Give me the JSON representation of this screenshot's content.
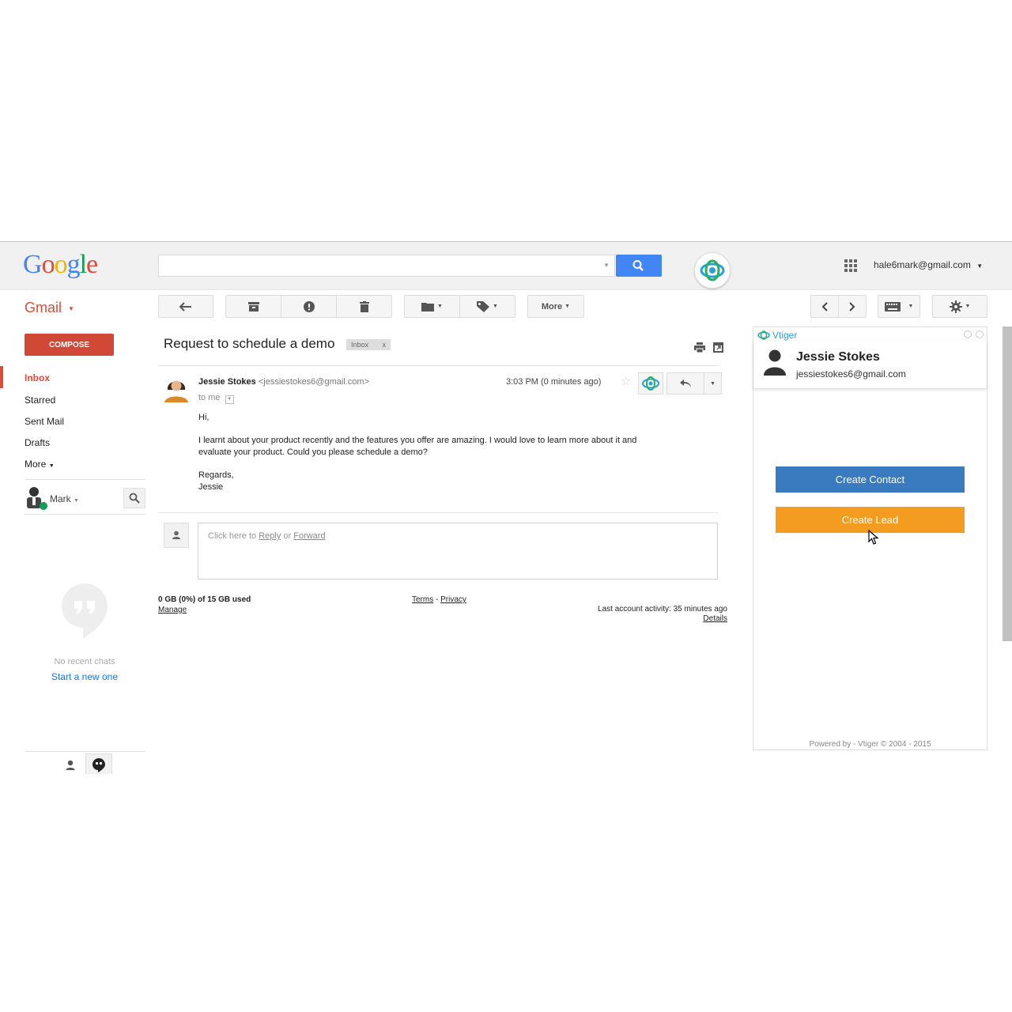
{
  "header": {
    "logo_letters": [
      {
        "char": "G",
        "color": "#4285f4"
      },
      {
        "char": "o",
        "color": "#dd4b39"
      },
      {
        "char": "o",
        "color": "#f4b400"
      },
      {
        "char": "g",
        "color": "#4285f4"
      },
      {
        "char": "l",
        "color": "#0f9d58"
      },
      {
        "char": "e",
        "color": "#dd4b39"
      }
    ],
    "account_email": "hale6mark@gmail.com",
    "search_placeholder": ""
  },
  "toolbar": {
    "gmail_label": "Gmail",
    "more_label": "More"
  },
  "sidebar": {
    "compose_label": "COMPOSE",
    "nav_items": [
      {
        "label": "Inbox"
      },
      {
        "label": "Starred"
      },
      {
        "label": "Sent Mail"
      },
      {
        "label": "Drafts"
      },
      {
        "label": "More"
      }
    ],
    "user_name": "Mark",
    "no_chats": "No recent chats",
    "start_new": "Start a new one"
  },
  "email": {
    "subject": "Request to schedule a demo",
    "label_chip": "Inbox",
    "label_chip_close": "x",
    "sender_name": "Jessie Stokes",
    "sender_email": "<jessiestokes6@gmail.com>",
    "to_line": "to me",
    "timestamp": "3:03 PM (0 minutes ago)",
    "body": {
      "greeting": "Hi,",
      "line1": "I learnt about your product recently and the features you offer are amazing. I would love to learn more about it and",
      "line2": "evaluate your product. Could you please schedule a demo?",
      "regards": "Regards,",
      "signature": "Jessie"
    },
    "reply_prompt_prefix": "Click here to",
    "reply_link": "Reply",
    "reply_or": "or",
    "forward_link": "Forward"
  },
  "footer": {
    "storage": "0 GB (0%) of 15 GB used",
    "manage": "Manage",
    "terms": "Terms",
    "dash": "-",
    "privacy": "Privacy",
    "last_activity": "Last account activity: 35 minutes ago",
    "details": "Details"
  },
  "vtiger": {
    "title": "Vtiger",
    "contact_name": "Jessie Stokes",
    "contact_email": "jessiestokes6@gmail.com",
    "create_contact": "Create Contact",
    "create_lead": "Create Lead",
    "powered_by": "Powered by - Vtiger © 2004 - 2015"
  },
  "colors": {
    "compose": "#d14836",
    "gmail_red": "#dd4b39",
    "search_blue": "#4285f4",
    "create_contact_blue": "#3a7bbf",
    "create_lead_orange": "#f39c1f",
    "link_blue": "#1a73e8"
  }
}
